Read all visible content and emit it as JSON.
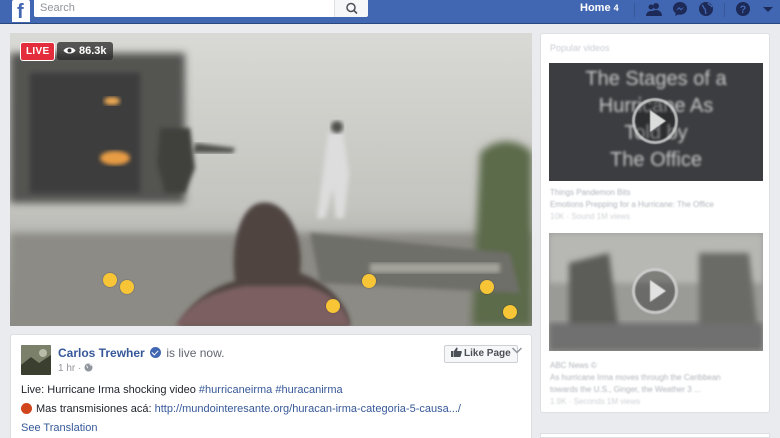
{
  "topbar": {
    "logo": "f",
    "search_placeholder": "Search",
    "home_label": "Home",
    "home_count": "4",
    "icons": [
      "friends-icon",
      "messenger-icon",
      "globe-icon",
      "help-icon",
      "caret-down-icon"
    ]
  },
  "video": {
    "live_label": "LIVE",
    "views": "86.3k",
    "reaction_colors": {
      "wow": "#f7c536",
      "sad": "#f7c536"
    }
  },
  "post": {
    "author": "Carlos Trewher",
    "status": "is live now.",
    "time": "1 hr ·",
    "like_page_label": "Like Page",
    "text_prefix": "Live: Hurricane Irma shocking video ",
    "hashtag1": "#hurricaneirma",
    "hashtag2": "#huracanirma",
    "line2_text": "Mas transmisiones acá: ",
    "line2_link": "http://mundointeresante.org/huracan-irma-categoria-5-causa.../",
    "see_translation": "See Translation"
  },
  "sidebar": {
    "title": "Popular videos",
    "video1": {
      "thumb_text_1": "The Stages of a",
      "thumb_text_2": "Hurricane As",
      "thumb_text_3": "Told by",
      "thumb_text_4": "The Office",
      "title": "Things Pandemon Bits",
      "subtitle": "Emotions Prepping for a Hurricane: The Office",
      "meta": "10K · Sound 1M views"
    },
    "video2": {
      "source": "ABC News ©",
      "subtitle_1": "As hurricane Irma moves through the Caribbean",
      "subtitle_2": "towards the U.S., Ginger, the Weather 3 ...",
      "meta": "1.9K · Seconds 1M views"
    }
  },
  "colors": {
    "brand_blue": "#4267b2",
    "live_red": "#e42d3c",
    "link_blue": "#365899"
  }
}
